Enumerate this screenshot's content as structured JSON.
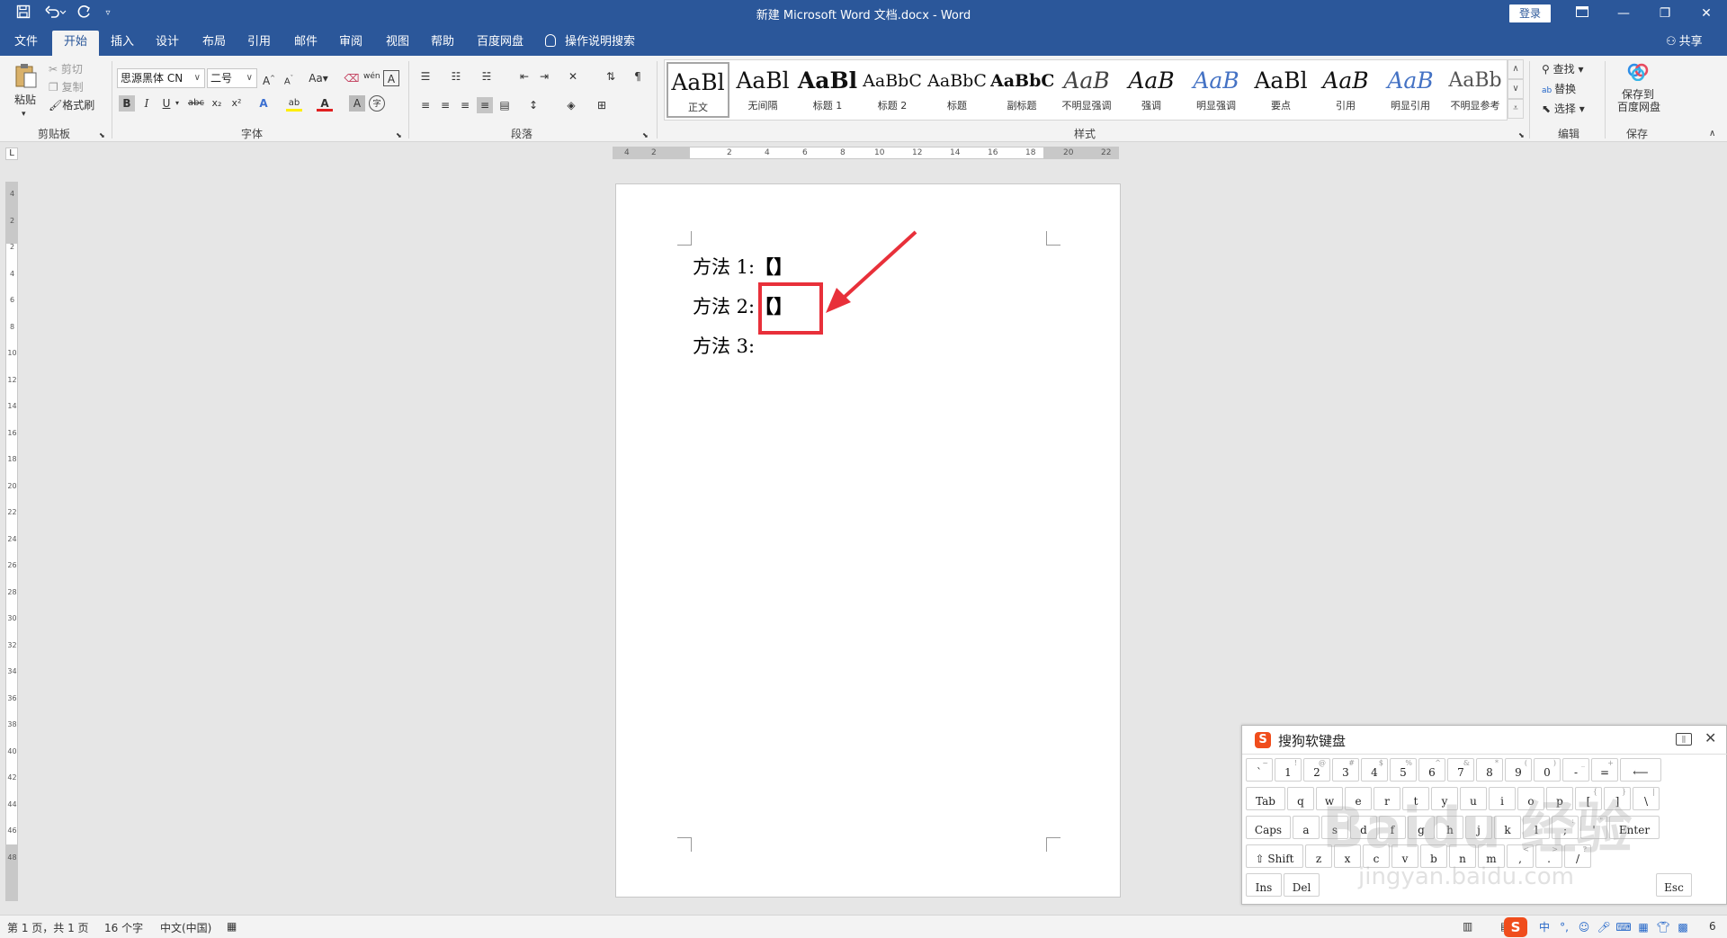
{
  "window": {
    "title": "新建 Microsoft Word 文档.docx  -  Word",
    "login_label": "登录",
    "quick_access": {
      "save_icon": "save-icon",
      "undo_icon": "undo-icon",
      "redo_icon": "redo-icon",
      "customize_icon": "customize-icon"
    },
    "controls": {
      "ribbon_display_icon": "ribbon-display-icon",
      "minimize_icon": "minimize-icon",
      "restore_icon": "restore-icon",
      "close_icon": "close-icon"
    }
  },
  "tabs": [
    {
      "label": "文件"
    },
    {
      "label": "开始",
      "active": true
    },
    {
      "label": "插入"
    },
    {
      "label": "设计"
    },
    {
      "label": "布局"
    },
    {
      "label": "引用"
    },
    {
      "label": "邮件"
    },
    {
      "label": "审阅"
    },
    {
      "label": "视图"
    },
    {
      "label": "帮助"
    },
    {
      "label": "百度网盘"
    }
  ],
  "tell_me": "操作说明搜索",
  "share": "共享",
  "ribbon": {
    "clipboard": {
      "label": "剪贴板",
      "paste": "粘贴",
      "cut": "剪切",
      "copy": "复制",
      "format_painter": "格式刷"
    },
    "font": {
      "label": "字体",
      "font_name": "思源黑体 CN",
      "font_size": "二号",
      "grow": "A",
      "shrink": "A",
      "change_case": "Aa",
      "phonetic": "wén",
      "bold": "B",
      "italic": "I",
      "underline": "U",
      "strike": "abc",
      "subscript": "x₂",
      "superscript": "x²",
      "text_effect": "A",
      "highlight": "ab",
      "font_color": "A",
      "shading": "A",
      "enclose": "字"
    },
    "paragraph": {
      "label": "段落"
    },
    "styles": {
      "label": "样式",
      "items": [
        {
          "sample": "AaBl",
          "name": "正文",
          "selected": true
        },
        {
          "sample": "AaBl",
          "name": "无间隔"
        },
        {
          "sample": "AaBl",
          "name": "标题 1"
        },
        {
          "sample": "AaBbC",
          "name": "标题 2"
        },
        {
          "sample": "AaBbC",
          "name": "标题"
        },
        {
          "sample": "AaBbC",
          "name": "副标题"
        },
        {
          "sample": "AaB",
          "name": "不明显强调"
        },
        {
          "sample": "AaB",
          "name": "强调"
        },
        {
          "sample": "AaB",
          "name": "明显强调"
        },
        {
          "sample": "AaBl",
          "name": "要点"
        },
        {
          "sample": "AaB",
          "name": "引用"
        },
        {
          "sample": "AaB",
          "name": "明显引用"
        },
        {
          "sample": "AaBb",
          "name": "不明显参考"
        }
      ]
    },
    "editing": {
      "label": "编辑",
      "find": "查找",
      "replace": "替换",
      "select": "选择"
    },
    "save": {
      "label": "保存",
      "save_to_baidu_line1": "保存到",
      "save_to_baidu_line2": "百度网盘"
    }
  },
  "ruler": {
    "horizontal_ticks": [
      "4",
      "2",
      "2",
      "4",
      "6",
      "8",
      "10",
      "12",
      "14",
      "16",
      "18",
      "20",
      "22"
    ],
    "vertical_ticks": [
      "4",
      "2",
      "2",
      "4",
      "6",
      "8",
      "10",
      "12",
      "14",
      "16",
      "18",
      "20",
      "22",
      "24",
      "26",
      "28",
      "30",
      "32",
      "34",
      "36",
      "38",
      "40",
      "42",
      "44",
      "46",
      "48"
    ],
    "corner": "L"
  },
  "document": {
    "lines": [
      {
        "label": "方法 1:",
        "bracket": "【】"
      },
      {
        "label": "方法 2:",
        "bracket": "【】"
      },
      {
        "label": "方法 3:",
        "bracket": ""
      }
    ]
  },
  "keyboard": {
    "title": "搜狗软键盘",
    "keyboard_icon": "keyboard-icon",
    "close_icon": "close-icon",
    "rows": [
      [
        {
          "m": "`",
          "s": "~"
        },
        {
          "m": "1",
          "s": "!"
        },
        {
          "m": "2",
          "s": "@"
        },
        {
          "m": "3",
          "s": "#"
        },
        {
          "m": "4",
          "s": "$"
        },
        {
          "m": "5",
          "s": "%"
        },
        {
          "m": "6",
          "s": "^"
        },
        {
          "m": "7",
          "s": "&"
        },
        {
          "m": "8",
          "s": "*"
        },
        {
          "m": "9",
          "s": "("
        },
        {
          "m": "0",
          "s": ")"
        },
        {
          "m": "-",
          "s": "_"
        },
        {
          "m": "=",
          "s": "+"
        },
        {
          "m": "⟵",
          "s": ""
        }
      ],
      [
        {
          "m": "Tab",
          "s": ""
        },
        {
          "m": "q",
          "s": ""
        },
        {
          "m": "w",
          "s": ""
        },
        {
          "m": "e",
          "s": ""
        },
        {
          "m": "r",
          "s": ""
        },
        {
          "m": "t",
          "s": ""
        },
        {
          "m": "y",
          "s": ""
        },
        {
          "m": "u",
          "s": ""
        },
        {
          "m": "i",
          "s": ""
        },
        {
          "m": "o",
          "s": ""
        },
        {
          "m": "p",
          "s": ""
        },
        {
          "m": "[",
          "s": "{"
        },
        {
          "m": "]",
          "s": "}"
        },
        {
          "m": "\\",
          "s": "|"
        }
      ],
      [
        {
          "m": "Caps",
          "s": ""
        },
        {
          "m": "a",
          "s": ""
        },
        {
          "m": "s",
          "s": ""
        },
        {
          "m": "d",
          "s": ""
        },
        {
          "m": "f",
          "s": ""
        },
        {
          "m": "g",
          "s": ""
        },
        {
          "m": "h",
          "s": ""
        },
        {
          "m": "j",
          "s": ""
        },
        {
          "m": "k",
          "s": ""
        },
        {
          "m": "l",
          "s": ""
        },
        {
          "m": ";",
          "s": ":"
        },
        {
          "m": "'",
          "s": "\""
        },
        {
          "m": "Enter",
          "s": ""
        }
      ],
      [
        {
          "m": "⇧ Shift",
          "s": ""
        },
        {
          "m": "z",
          "s": ""
        },
        {
          "m": "x",
          "s": ""
        },
        {
          "m": "c",
          "s": ""
        },
        {
          "m": "v",
          "s": ""
        },
        {
          "m": "b",
          "s": ""
        },
        {
          "m": "n",
          "s": ""
        },
        {
          "m": "m",
          "s": ""
        },
        {
          "m": ",",
          "s": "<"
        },
        {
          "m": ".",
          "s": ">"
        },
        {
          "m": "/",
          "s": "?"
        }
      ],
      [
        {
          "m": "Ins",
          "s": ""
        },
        {
          "m": "Del",
          "s": ""
        },
        {
          "m": "",
          "s": ""
        },
        {
          "m": "Esc",
          "s": ""
        }
      ]
    ]
  },
  "status": {
    "page": "第 1 页，共 1 页",
    "words": "16 个字",
    "language": "中文(中国)",
    "tray_lang": "中",
    "zoom_end": "6"
  },
  "watermark": {
    "text": "Baidu 经验",
    "url": "jingyan.baidu.com"
  },
  "colors": {
    "title_blue": "#2b579a",
    "highlight_red": "#e8303a",
    "sogou_orange": "#f04d1c"
  }
}
